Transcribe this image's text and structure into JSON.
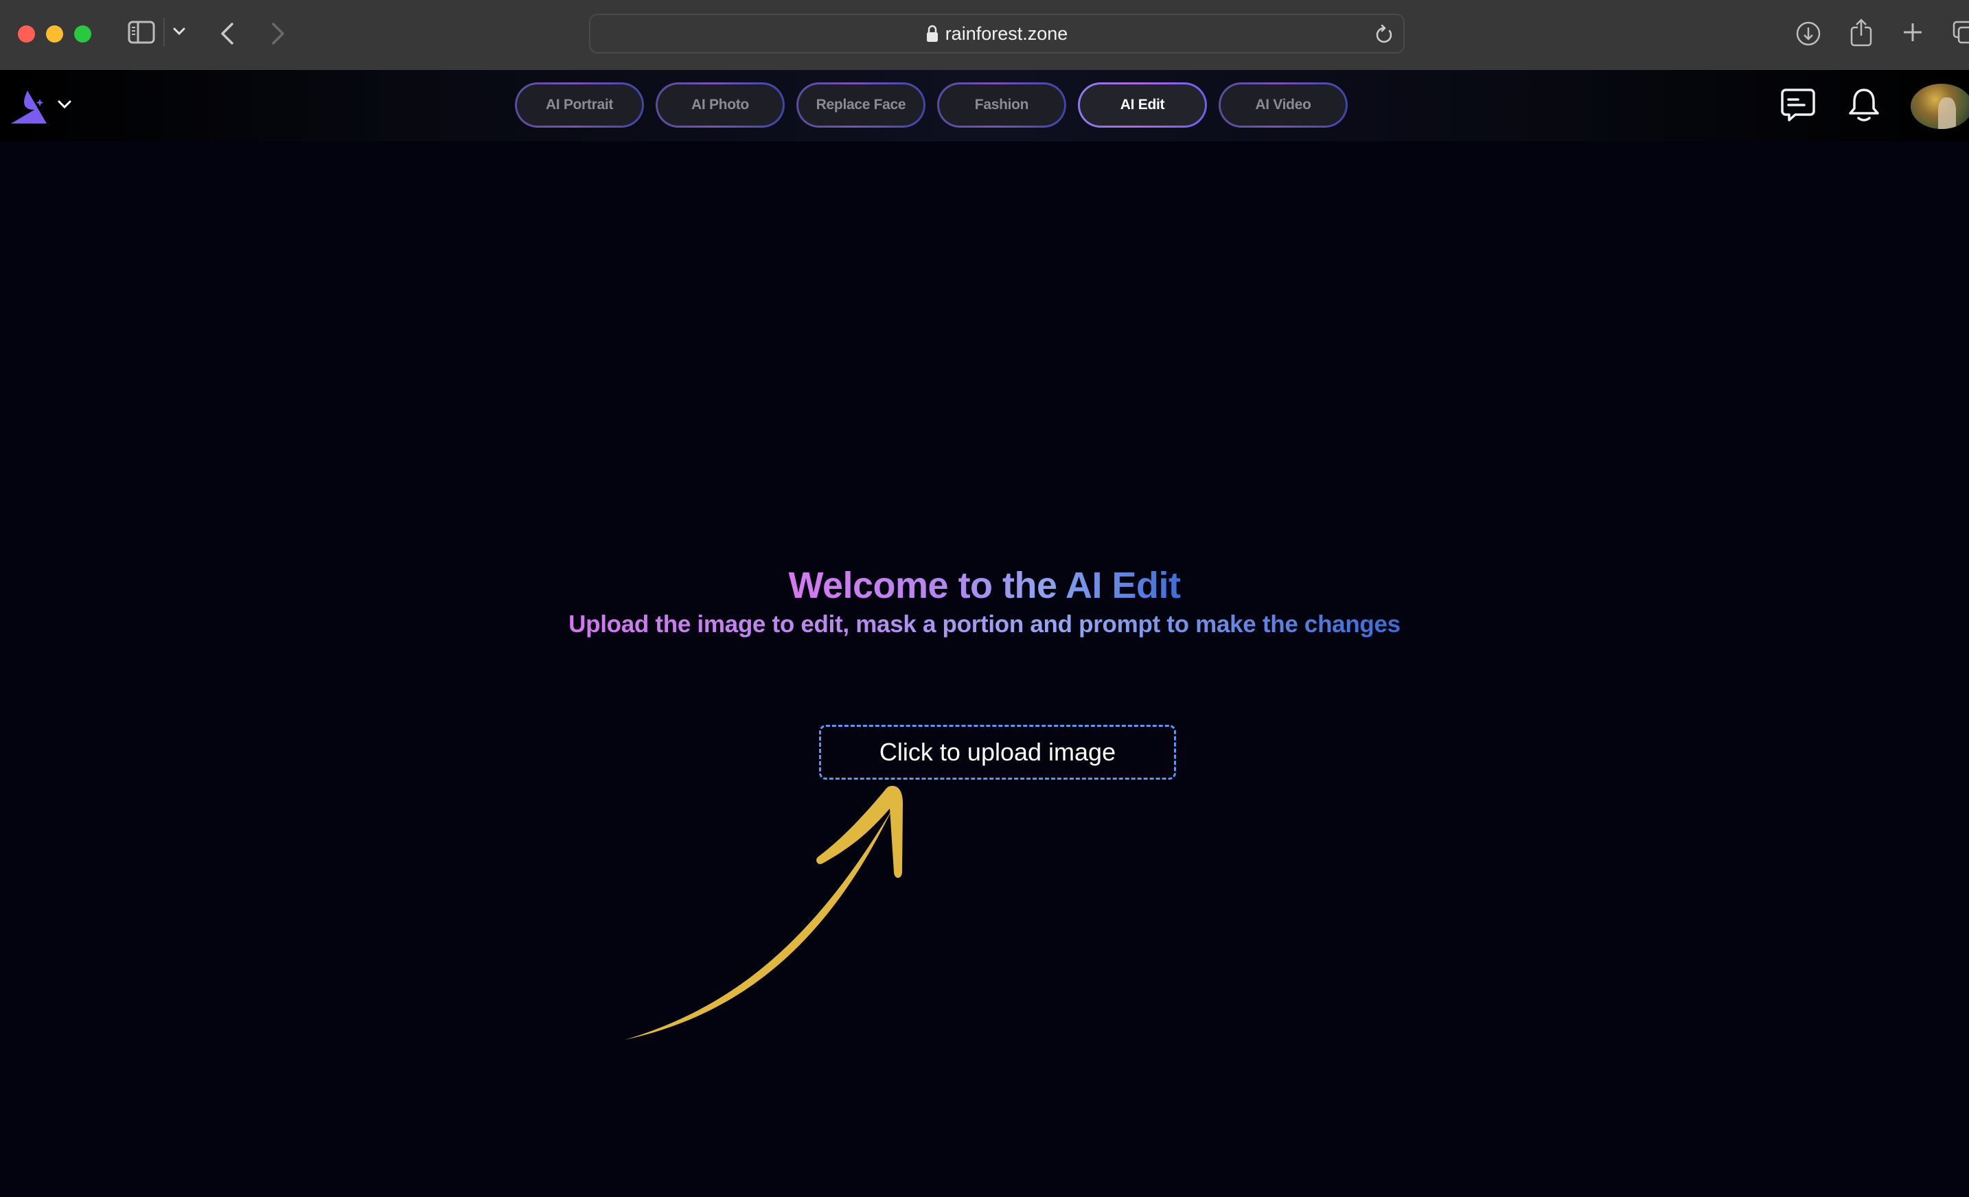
{
  "browser": {
    "url": "rainforest.zone",
    "icons": [
      "close-window",
      "minimize-window",
      "maximize-window",
      "sidebar-toggle",
      "chevron-down",
      "back",
      "forward",
      "lock",
      "reload",
      "download",
      "share",
      "new-tab",
      "tab-overview"
    ]
  },
  "header": {
    "logo": "triangle-sparkle-logo",
    "tabs": [
      {
        "label": "AI Portrait",
        "active": false
      },
      {
        "label": "AI Photo",
        "active": false
      },
      {
        "label": "Replace Face",
        "active": false
      },
      {
        "label": "Fashion",
        "active": false
      },
      {
        "label": "AI Edit",
        "active": true
      },
      {
        "label": "AI Video",
        "active": false
      }
    ],
    "right_icons": [
      "chat-icon",
      "bell-icon",
      "avatar"
    ]
  },
  "main": {
    "title": "Welcome to the AI Edit",
    "subtitle": "Upload the image to edit, mask a portion and prompt to make the changes",
    "upload_label": "Click to upload image"
  },
  "colors": {
    "accent_purple": "#7b5cf0",
    "gradient_start": "#d878f0",
    "gradient_end": "#3d6fd8",
    "upload_border": "#5b97f0",
    "arrow": "#e0b840",
    "background": "#03030f"
  }
}
